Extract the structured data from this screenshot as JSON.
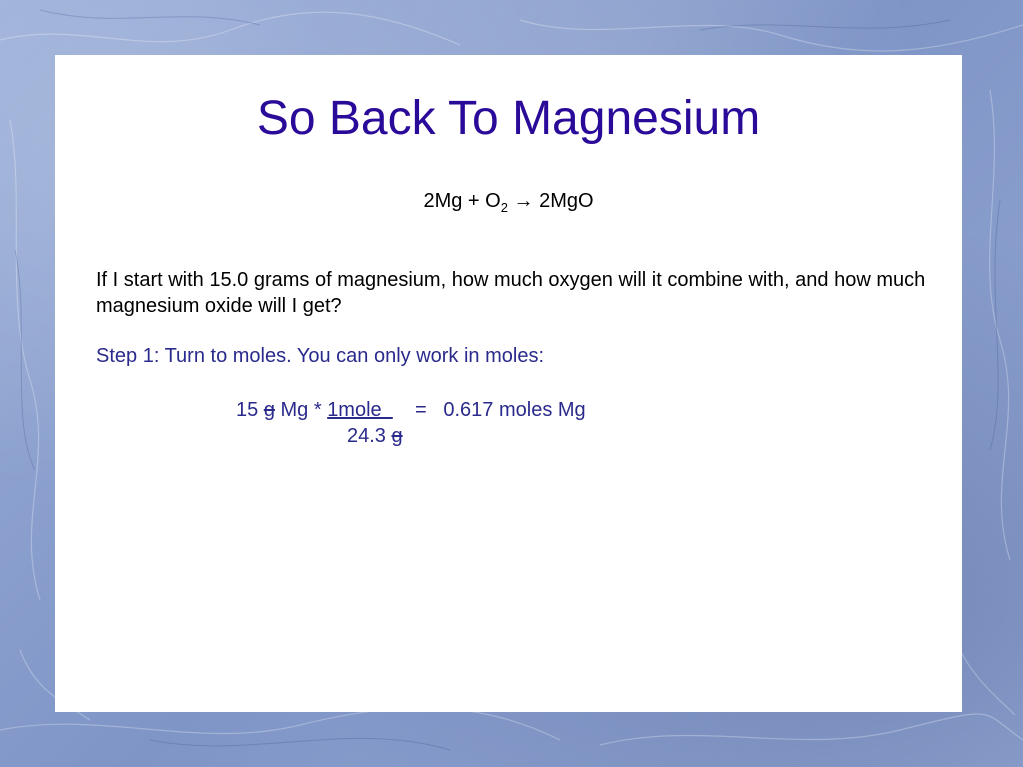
{
  "slide": {
    "title": "So Back To Magnesium",
    "equation": {
      "left": "2Mg + O",
      "sub": "2",
      "arrow": "→",
      "right": "2MgO"
    },
    "question": "If I start with 15.0 grams of magnesium, how much oxygen will it combine with, and how much magnesium oxide will I get?",
    "step": "Step 1: Turn to moles. You can only work in moles:",
    "calc": {
      "mass": "15 ",
      "unit_g": "g",
      "element": " Mg * ",
      "numerator": "1mole  ",
      "equals": "    =   0.617 moles Mg",
      "denominator": "24.3 ",
      "denominator_unit": "g"
    }
  },
  "colors": {
    "title": "#2a0a99",
    "body_text": "#000000",
    "step_text": "#2a2a8c",
    "background": "#8ea2cf"
  }
}
